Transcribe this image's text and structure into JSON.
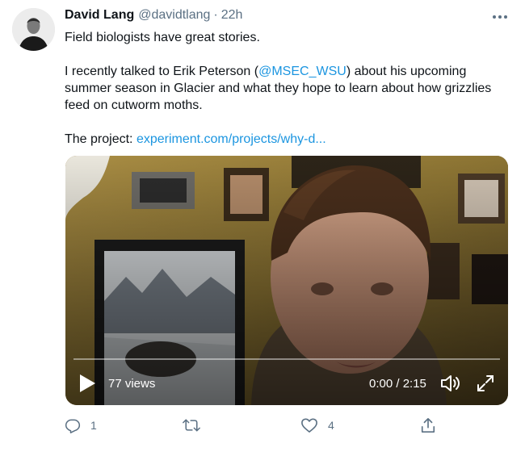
{
  "author": {
    "name": "David Lang",
    "handle": "@davidtlang",
    "separator": "·",
    "time": "22h"
  },
  "tweet": {
    "line1": "Field biologists have great stories.",
    "line2_before": "I recently talked to Erik Peterson (",
    "line2_mention": "@MSEC_WSU",
    "line2_after": ") about his upcoming summer season in Glacier and what they hope to learn about how grizzlies feed on cutworm moths.",
    "line3_prefix": "The project: ",
    "line3_link": "experiment.com/projects/why-d..."
  },
  "video": {
    "views": "77 views",
    "time": "0:00 / 2:15",
    "progress": 0
  },
  "actions": {
    "reply_count": "1",
    "retweet_count": "",
    "like_count": "4"
  },
  "colors": {
    "link": "#1b95e0",
    "secondary_text": "#5b7083",
    "primary_text": "#0f1419"
  },
  "icons": [
    "more-icon",
    "play-icon",
    "volume-icon",
    "fullscreen-icon",
    "reply-icon",
    "retweet-icon",
    "like-icon",
    "share-icon"
  ]
}
